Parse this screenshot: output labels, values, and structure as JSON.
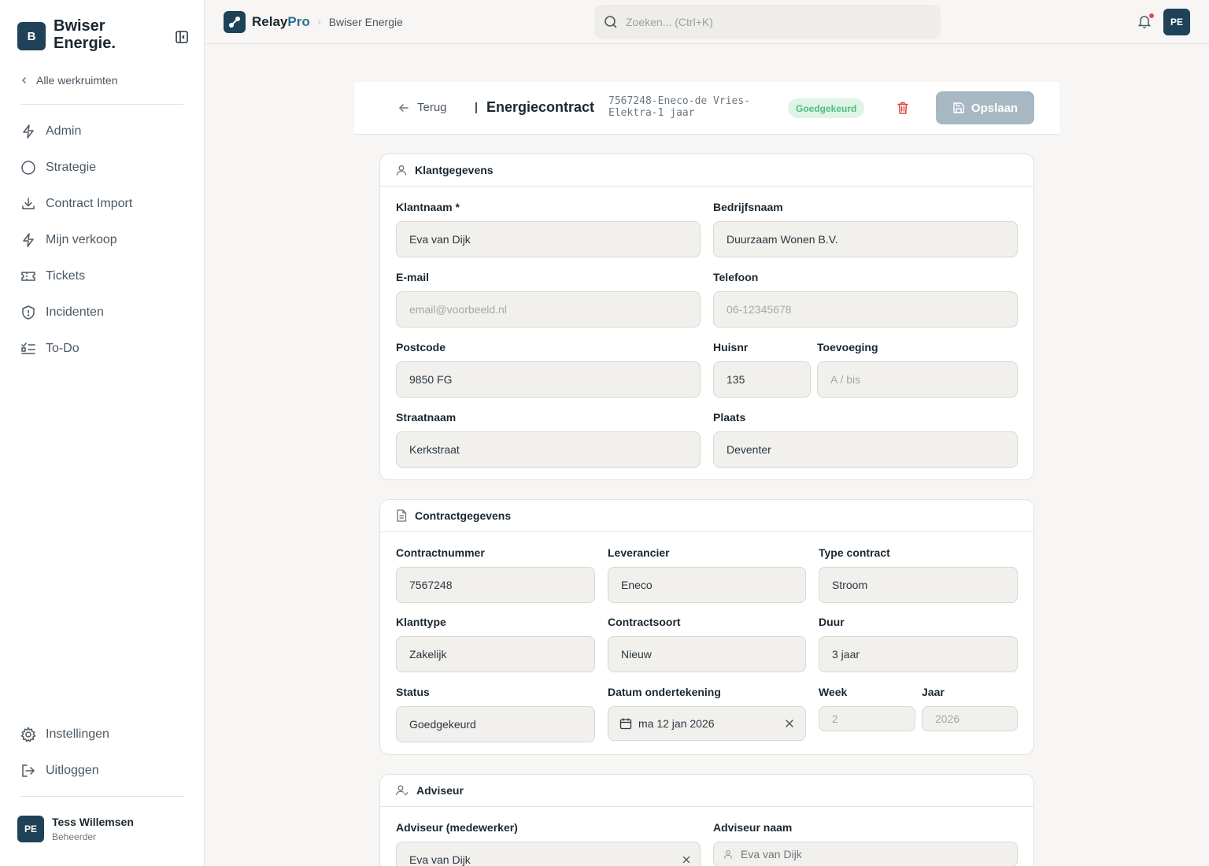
{
  "brand": {
    "badge": "B",
    "name": "Bwiser Energie."
  },
  "sidebar": {
    "all_workspaces": "Alle werkruimten",
    "items": [
      {
        "label": "Admin",
        "icon": "lightning-icon"
      },
      {
        "label": "Strategie",
        "icon": "circle-icon"
      },
      {
        "label": "Contract Import",
        "icon": "download-icon"
      },
      {
        "label": "Mijn verkoop",
        "icon": "lightning-icon"
      },
      {
        "label": "Tickets",
        "icon": "ticket-icon"
      },
      {
        "label": "Incidenten",
        "icon": "shield-icon"
      },
      {
        "label": "To-Do",
        "icon": "checklist-icon"
      }
    ],
    "bottom_items": [
      {
        "label": "Instellingen",
        "icon": "gear-icon"
      },
      {
        "label": "Uitloggen",
        "icon": "logout-icon"
      }
    ],
    "user": {
      "initials": "PE",
      "name": "Tess Willemsen",
      "role": "Beheerder"
    }
  },
  "topbar": {
    "logo_main": "Relay",
    "logo_accent": "Pro",
    "breadcrumb": "Bwiser Energie",
    "search_placeholder": "Zoeken... (Ctrl+K)",
    "avatar_initials": "PE"
  },
  "header": {
    "back_label": "Terug",
    "title": "Energiecontract",
    "contract_id": "7567248-Eneco-de Vries-Elektra-1 jaar",
    "status": "Goedgekeurd",
    "save_label": "Opslaan"
  },
  "klant": {
    "heading": "Klantgegevens",
    "klantnaam": {
      "label": "Klantnaam *",
      "value": "Eva van Dijk"
    },
    "bedrijfsnaam": {
      "label": "Bedrijfsnaam",
      "value": "Duurzaam Wonen B.V."
    },
    "email": {
      "label": "E-mail",
      "placeholder": "email@voorbeeld.nl"
    },
    "telefoon": {
      "label": "Telefoon",
      "placeholder": "06-12345678"
    },
    "postcode": {
      "label": "Postcode",
      "value": "9850 FG"
    },
    "huisnr": {
      "label": "Huisnr",
      "value": "135"
    },
    "toevoeging": {
      "label": "Toevoeging",
      "placeholder": "A / bis"
    },
    "straatnaam": {
      "label": "Straatnaam",
      "value": "Kerkstraat"
    },
    "plaats": {
      "label": "Plaats",
      "value": "Deventer"
    }
  },
  "contract": {
    "heading": "Contractgegevens",
    "contractnummer": {
      "label": "Contractnummer",
      "value": "7567248"
    },
    "leverancier": {
      "label": "Leverancier",
      "value": "Eneco"
    },
    "type": {
      "label": "Type contract",
      "value": "Stroom"
    },
    "klanttype": {
      "label": "Klanttype",
      "value": "Zakelijk"
    },
    "contractsoort": {
      "label": "Contractsoort",
      "value": "Nieuw"
    },
    "duur": {
      "label": "Duur",
      "value": "3 jaar"
    },
    "status": {
      "label": "Status",
      "value": "Goedgekeurd"
    },
    "datum": {
      "label": "Datum ondertekening",
      "value": "ma 12 jan 2026"
    },
    "week": {
      "label": "Week",
      "value": "2"
    },
    "jaar": {
      "label": "Jaar",
      "value": "2026"
    }
  },
  "adviseur": {
    "heading": "Adviseur",
    "medewerker": {
      "label": "Adviseur (medewerker)",
      "value": "Eva van Dijk"
    },
    "naam": {
      "label": "Adviseur naam",
      "value": "Eva van Dijk"
    }
  },
  "colors": {
    "primary": "#1f4258",
    "accent": "#2e6e8f",
    "success_bg": "#dff3e6",
    "success_text": "#4fbf7d",
    "danger": "#d9473f"
  }
}
